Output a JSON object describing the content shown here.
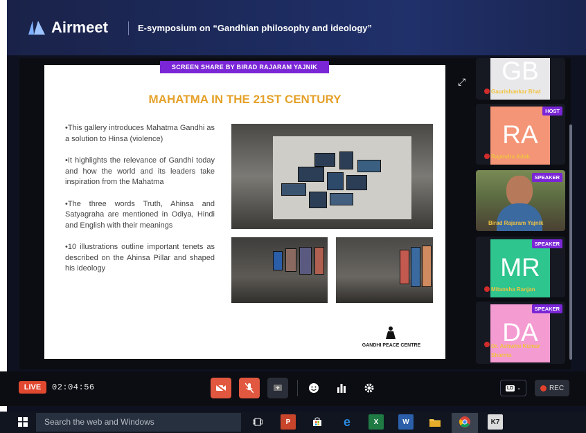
{
  "app": {
    "name": "Airmeet",
    "event_title": "E-symposium on “Gandhian philosophy and ideology”"
  },
  "stage": {
    "share_banner": "SCREEN SHARE BY BIRAD RAJARAM YAJNIK",
    "slide": {
      "title": "MAHATMA IN THE 21ST CENTURY",
      "bullets": [
        "•This gallery introduces Mahatma Gandhi as a solution to Hinsa (violence)",
        "•It highlights the relevance of Gandhi today and how the world and its leaders take inspiration from the Mahatma",
        "•The three words Truth, Ahinsa and Satyagraha are mentioned in Odiya, Hindi and English with their meanings",
        "•10 illustrations outline important tenets as described on the Ahinsa Pillar and shaped his ideology"
      ],
      "logo_text": "GANDHI PEACE CENTRE"
    }
  },
  "participants": [
    {
      "initials": "GB",
      "name": "Gaurishankar Bhat",
      "badge": "",
      "color": "#e8e8ea"
    },
    {
      "initials": "RA",
      "name": "Rajendra Adak",
      "badge": "HOST",
      "color": "#f49577"
    },
    {
      "initials": "",
      "name": "Birad Rajaram Yajnik",
      "badge": "SPEAKER",
      "color": "#5e6f44"
    },
    {
      "initials": "MR",
      "name": "Mitansha Ranjan",
      "badge": "SPEAKER",
      "color": "#2ec58f"
    },
    {
      "initials": "DA",
      "name": "Dr. Ashwini Kumar Sharma",
      "badge": "SPEAKER",
      "color": "#f49bd2"
    }
  ],
  "controls": {
    "live_label": "LIVE",
    "timer": "02:04:56",
    "quality_label": "LD",
    "rec_label": "REC"
  },
  "taskbar": {
    "search_placeholder": "Search the web and Windows",
    "apps": [
      "task-view",
      "powerpoint",
      "store",
      "edge",
      "excel",
      "word",
      "file-explorer",
      "chrome",
      "k7"
    ]
  },
  "colors": {
    "accent": "#7a26d6",
    "live": "#e0492f",
    "slide_title": "#e5a12a"
  }
}
